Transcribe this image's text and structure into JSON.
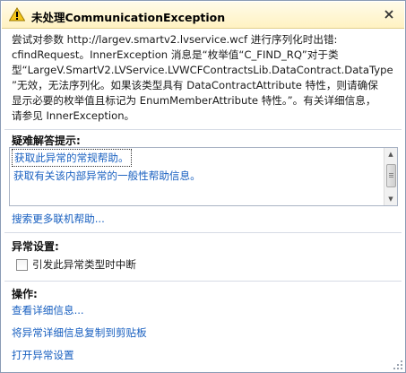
{
  "dialog": {
    "title": "未处理CommunicationException",
    "message": "尝试对参数 http://largev.smartv2.lvservice.wcf 进行序列化时出错:\ncfindRequest。InnerException 消息是“枚举值“C_FIND_RQ”对于类\n型“LargeV.SmartV2.LVService.LVWCFContractsLib.DataContract.DataType\n”无效，无法序列化。如果该类型具有 DataContractAttribute 特性，则请确保\n显示必要的枚举值且标记为 EnumMemberAttribute 特性。”。有关详细信息，\n请参见 InnerException。"
  },
  "troubleshooting": {
    "heading": "疑难解答提示:",
    "tips": [
      "获取此异常的常规帮助。",
      "获取有关该内部异常的一般性帮助信息。"
    ],
    "search_link": "搜索更多联机帮助..."
  },
  "exception_settings": {
    "heading": "异常设置:",
    "break_checkbox_label": "引发此异常类型时中断",
    "break_checked": false
  },
  "actions": {
    "heading": "操作:",
    "items": [
      "查看详细信息...",
      "将异常详细信息复制到剪贴板",
      "打开异常设置"
    ]
  },
  "colors": {
    "link": "#1960c0",
    "title_bg": "#fff2c2",
    "warning_icon": "#f5c518"
  }
}
